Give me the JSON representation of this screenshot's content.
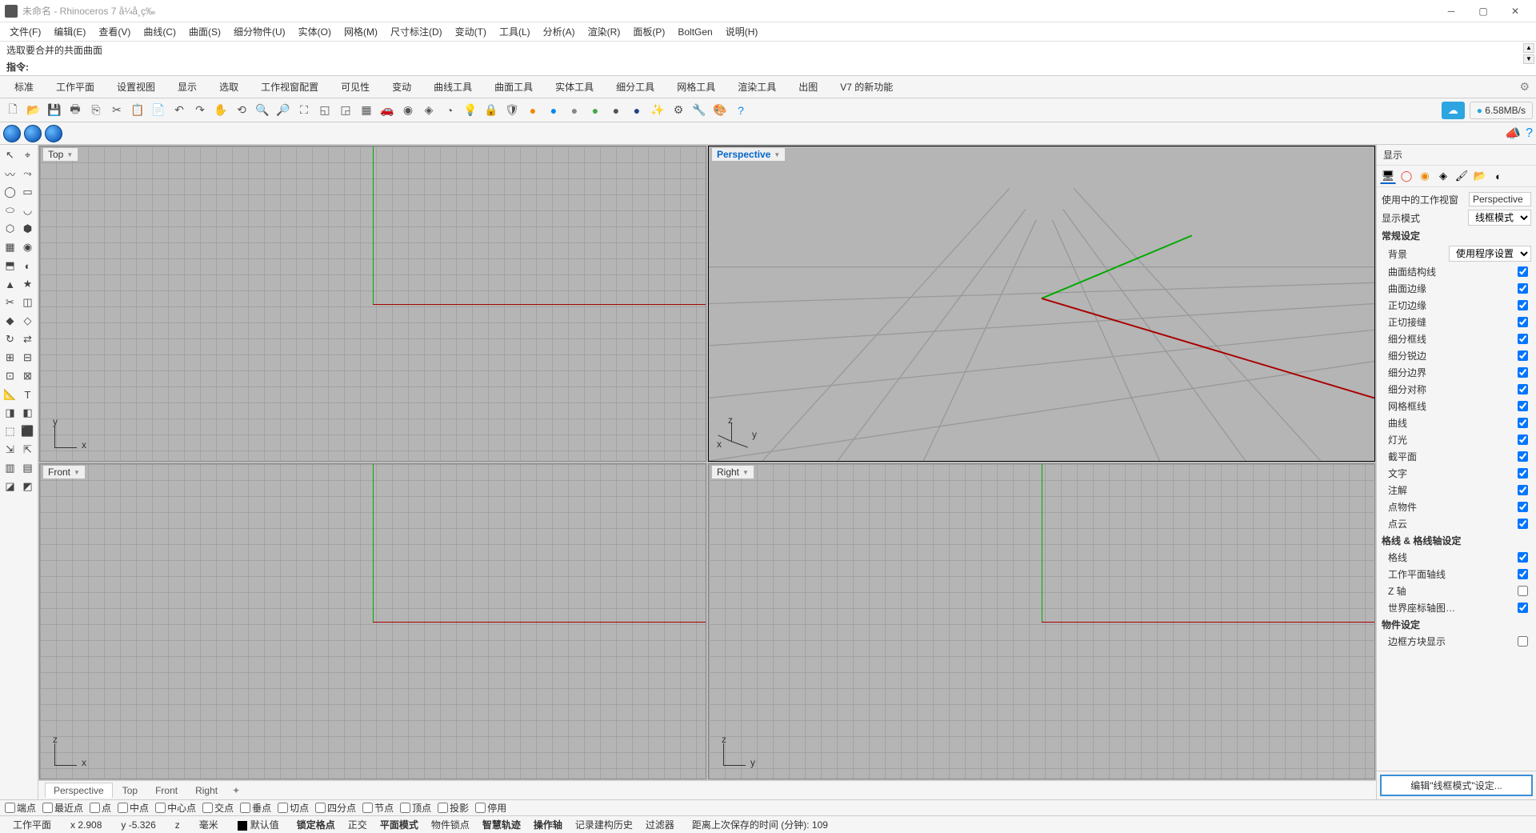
{
  "title": "未命名 - Rhinoceros 7 å¼å¸ç‰",
  "menus": [
    "文件(F)",
    "编辑(E)",
    "查看(V)",
    "曲线(C)",
    "曲面(S)",
    "细分物件(U)",
    "实体(O)",
    "网格(M)",
    "尺寸标注(D)",
    "变动(T)",
    "工具(L)",
    "分析(A)",
    "渲染(R)",
    "面板(P)",
    "BoltGen",
    "说明(H)"
  ],
  "cmd_history": "选取要合并的共面曲面",
  "cmd_prompt": "指令:",
  "tabs": [
    "标准",
    "工作平面",
    "设置视图",
    "显示",
    "选取",
    "工作视窗配置",
    "可见性",
    "变动",
    "曲线工具",
    "曲面工具",
    "实体工具",
    "细分工具",
    "网格工具",
    "渲染工具",
    "出图",
    "V7 的新功能"
  ],
  "cloud_speed": "6.58MB/s",
  "viewports": {
    "tl": "Top",
    "tr": "Perspective",
    "bl": "Front",
    "br": "Right"
  },
  "vp_tabs": [
    "Perspective",
    "Top",
    "Front",
    "Right"
  ],
  "panel_title": "显示",
  "panel": {
    "active_vp_label": "使用中的工作视窗",
    "active_vp_value": "Perspective",
    "display_mode_label": "显示模式",
    "display_mode_value": "线框模式",
    "general_header": "常规设定",
    "bg_label": "背景",
    "bg_value": "使用程序设置",
    "checks": [
      {
        "label": "曲面结构线",
        "v": true
      },
      {
        "label": "曲面边缘",
        "v": true
      },
      {
        "label": "正切边缘",
        "v": true
      },
      {
        "label": "正切接缝",
        "v": true
      },
      {
        "label": "细分框线",
        "v": true
      },
      {
        "label": "细分锐边",
        "v": true
      },
      {
        "label": "细分边界",
        "v": true
      },
      {
        "label": "细分对称",
        "v": true
      },
      {
        "label": "网格框线",
        "v": true
      },
      {
        "label": "曲线",
        "v": true
      },
      {
        "label": "灯光",
        "v": true
      },
      {
        "label": "截平面",
        "v": true
      },
      {
        "label": "文字",
        "v": true
      },
      {
        "label": "注解",
        "v": true
      },
      {
        "label": "点物件",
        "v": true
      },
      {
        "label": "点云",
        "v": true
      }
    ],
    "grid_header": "格线 & 格线轴设定",
    "grid_checks": [
      {
        "label": "格线",
        "v": true
      },
      {
        "label": "工作平面轴线",
        "v": true
      },
      {
        "label": "Z 轴",
        "v": false
      },
      {
        "label": "世界座标轴图…",
        "v": true
      }
    ],
    "object_header": "物件设定",
    "last_check": {
      "label": "边框方块显示",
      "v": false
    },
    "edit_btn": "编辑\"线框模式\"设定..."
  },
  "osnap": [
    "端点",
    "最近点",
    "点",
    "中点",
    "中心点",
    "交点",
    "垂点",
    "切点",
    "四分点",
    "节点",
    "顶点",
    "投影",
    "停用"
  ],
  "status": {
    "cplane": "工作平面",
    "x": "x 2.908",
    "y": "y -5.326",
    "z": "z",
    "unit": "毫米",
    "layer": "默认值",
    "toggles": [
      "锁定格点",
      "正交",
      "平面模式",
      "物件锁点",
      "智慧轨迹",
      "操作轴",
      "记录建构历史",
      "过滤器"
    ],
    "autosave": "距离上次保存的时间 (分钟): 109"
  }
}
